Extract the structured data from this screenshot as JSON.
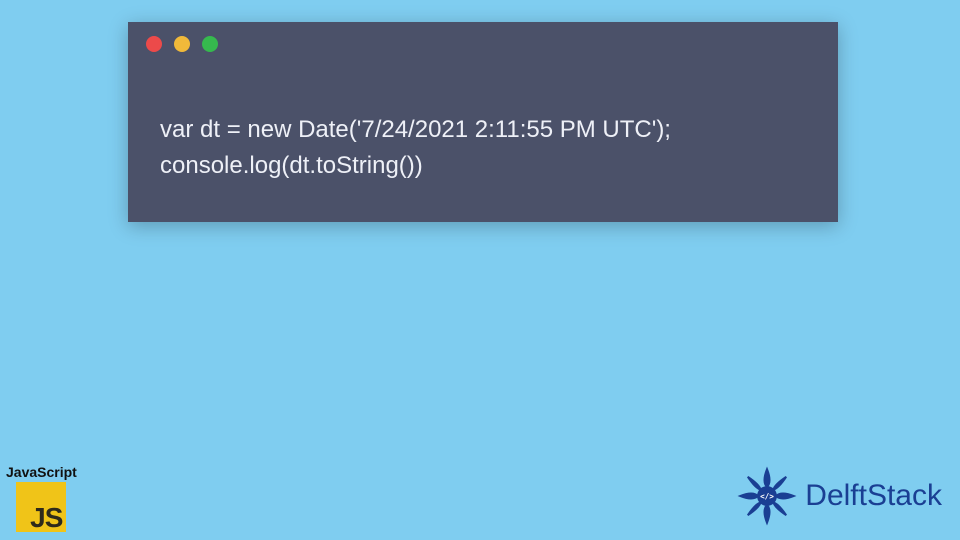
{
  "code": {
    "lines": [
      "var dt = new Date('7/24/2021 2:11:55 PM UTC');",
      "console.log(dt.toString())"
    ],
    "window_dots": [
      "red",
      "yellow",
      "green"
    ]
  },
  "badges": {
    "js_label": "JavaScript",
    "js_logo_text": "JS",
    "delft_text": "DelftStack"
  },
  "colors": {
    "page_bg": "#7fcdf0",
    "window_bg": "#4b5169",
    "code_fg": "#eef0f7",
    "js_yellow": "#f0c418",
    "delft_blue": "#1a3f93"
  }
}
